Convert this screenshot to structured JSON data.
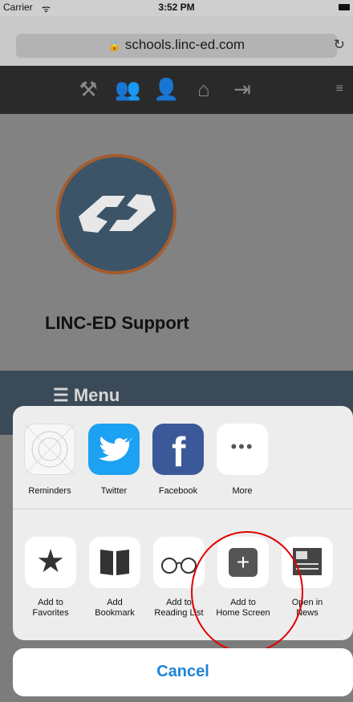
{
  "status": {
    "carrier": "Carrier",
    "wifi_icon": "wifi-icon",
    "time": "3:52 PM",
    "battery_icon": "battery-icon"
  },
  "browser": {
    "url": "schools.linc-ed.com",
    "lock_icon": "lock-icon",
    "reload_icon": "reload-icon"
  },
  "site_nav": {
    "icons": [
      "tools-icon",
      "users-icon",
      "user-icon",
      "home-icon",
      "logout-icon"
    ],
    "hamburger_icon": "hamburger-icon"
  },
  "site": {
    "title": "LINC-ED Support",
    "menu_label": "Menu"
  },
  "share_sheet": {
    "apps": [
      {
        "label": "Reminders",
        "icon": "reminders-icon"
      },
      {
        "label": "Twitter",
        "icon": "twitter-icon"
      },
      {
        "label": "Facebook",
        "icon": "facebook-icon"
      },
      {
        "label": "More",
        "icon": "more-icon"
      }
    ],
    "actions": [
      {
        "label_line1": "Add to",
        "label_line2": "Favorites",
        "icon": "star-icon"
      },
      {
        "label_line1": "Add",
        "label_line2": "Bookmark",
        "icon": "book-icon"
      },
      {
        "label_line1": "Add to",
        "label_line2": "Reading List",
        "icon": "glasses-icon"
      },
      {
        "label_line1": "Add to",
        "label_line2": "Home Screen",
        "icon": "plus-square-icon"
      },
      {
        "label_line1": "Open in",
        "label_line2": "News",
        "icon": "news-icon"
      }
    ],
    "cancel_label": "Cancel"
  },
  "colors": {
    "accent": "#1d84d6",
    "twitter": "#1da1f2",
    "facebook": "#3b5998",
    "highlight": "#e00000"
  }
}
